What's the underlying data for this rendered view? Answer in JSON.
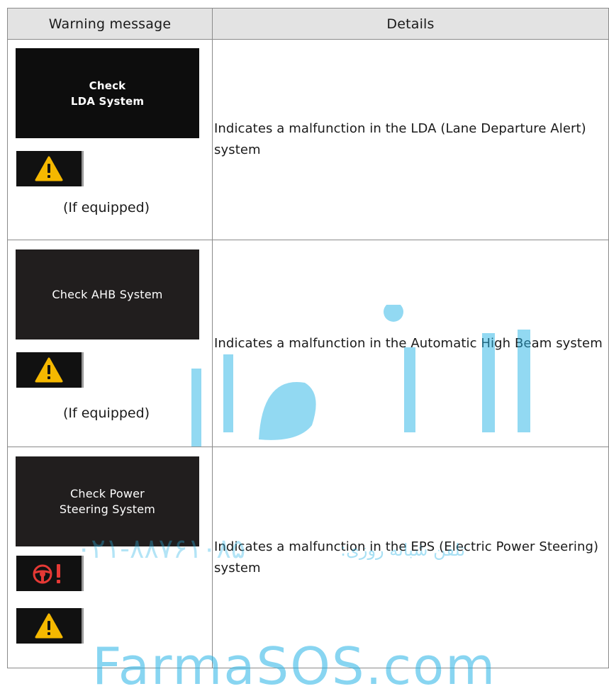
{
  "table": {
    "headers": {
      "warning": "Warning message",
      "details": "Details"
    },
    "rows": [
      {
        "screen_text": "Check\nLDA System",
        "equipped": "(If equipped)",
        "details": "Indicates a malfunction in the LDA (Lane Departure Alert) system"
      },
      {
        "screen_text": "Check AHB System",
        "equipped": "(If equipped)",
        "details": "Indicates a malfunction in the Automatic High Beam system"
      },
      {
        "screen_text": "Check Power\nSteering System",
        "details": "Indicates a malfunction in the EPS (Electric Power Steering) system"
      }
    ]
  },
  "watermark": {
    "phone": "۰۲۱-۸۸۷۶۱۰۸۵",
    "phone_label": "تلفن شبانه روزی:",
    "brand": "FarmaSOS.com"
  },
  "colors": {
    "amber": "#f5b800",
    "red": "#e53935",
    "watermark": "#27b4e6"
  }
}
